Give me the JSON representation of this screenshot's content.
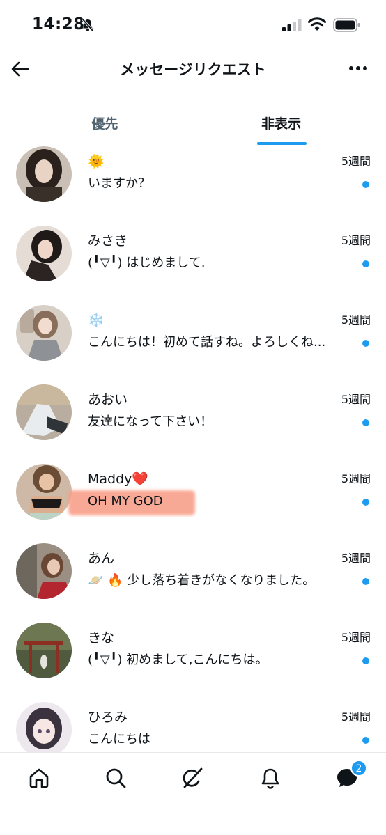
{
  "status_bar": {
    "time": "14:28"
  },
  "header": {
    "title": "メッセージリクエスト"
  },
  "tabs": [
    {
      "label": "優先",
      "active": false
    },
    {
      "label": "非表示",
      "active": true
    }
  ],
  "colors": {
    "accent": "#1d9bf0",
    "highlight": "#f8a08a",
    "muted": "#536471"
  },
  "messages": [
    {
      "name": "🌞",
      "preview": "いますか？",
      "time": "5週間",
      "unread": true
    },
    {
      "name": "みさき",
      "preview": "(╹▽╹) はじめまして.",
      "time": "5週間",
      "unread": true
    },
    {
      "name": "❄️",
      "preview": "こんにちは！初めて話すね。よろしくね...",
      "time": "5週間",
      "unread": true
    },
    {
      "name": "あおい",
      "preview": "友達になって下さい！",
      "time": "5週間",
      "unread": true
    },
    {
      "name": "Maddy❤️",
      "preview": "OH MY GOD",
      "time": "5週間",
      "unread": true,
      "highlighted": true
    },
    {
      "name": "あん",
      "preview": "🪐 🔥 少し落ち着きがなくなりました。",
      "time": "5週間",
      "unread": true
    },
    {
      "name": "きな",
      "preview": "(╹▽╹) 初めまして,こんにちは。",
      "time": "5週間",
      "unread": true
    },
    {
      "name": "ひろみ",
      "preview": "こんにちは",
      "time": "5週間",
      "unread": true
    }
  ],
  "bottom_nav": [
    {
      "icon": "home-icon"
    },
    {
      "icon": "search-icon"
    },
    {
      "icon": "grok-icon"
    },
    {
      "icon": "notifications-icon"
    },
    {
      "icon": "messages-icon",
      "badge": "2"
    }
  ]
}
